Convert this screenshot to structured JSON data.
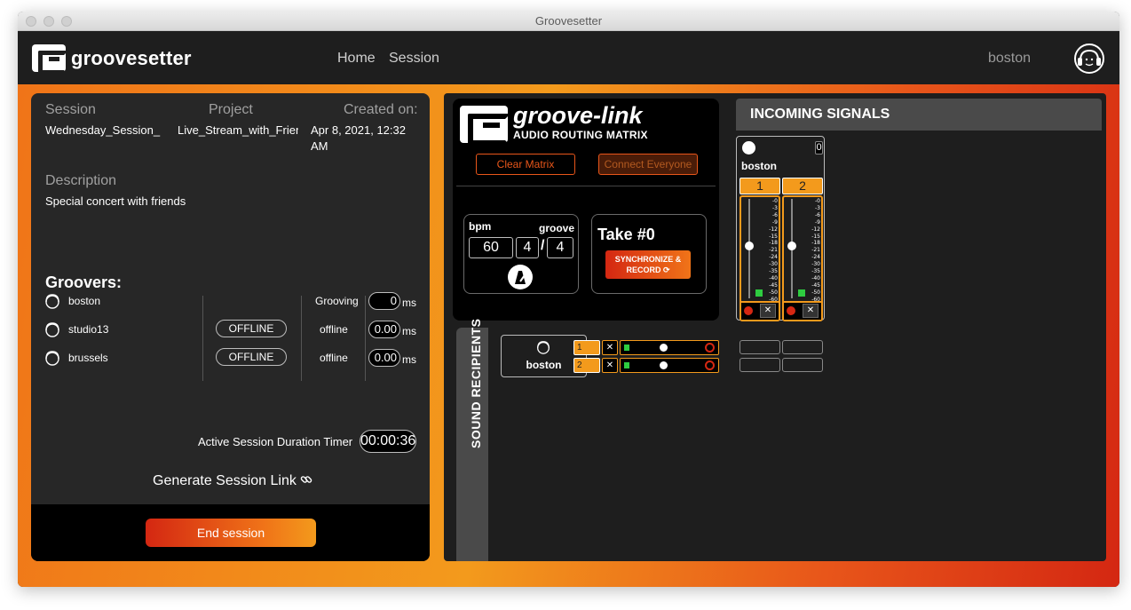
{
  "window": {
    "title": "Groovesetter"
  },
  "nav": {
    "brand": "groovesetter",
    "links": [
      "Home",
      "Session"
    ],
    "user": "boston"
  },
  "session": {
    "session_label": "Session",
    "project_label": "Project",
    "created_label": "Created on:",
    "session_value": "Wednesday_Session_",
    "project_value": "Live_Stream_with_Frien",
    "created_value_1": "Apr 8, 2021, 12:32",
    "created_value_2": "AM",
    "description_label": "Description",
    "description_value": "Special concert with friends",
    "groovers_title": "Groovers:",
    "groovers": [
      {
        "name": "boston",
        "button": "",
        "state": "Grooving",
        "latency": "0",
        "unit": "ms"
      },
      {
        "name": "studio13",
        "button": "OFFLINE",
        "state": "offline",
        "latency": "0.00",
        "unit": "ms"
      },
      {
        "name": "brussels",
        "button": "OFFLINE",
        "state": "offline",
        "latency": "0.00",
        "unit": "ms"
      }
    ],
    "timer_label": "Active Session Duration Timer",
    "timer_value": "00:00:36",
    "generate_link": "Generate Session Link",
    "end_button": "End session"
  },
  "groove_link": {
    "title": "groove-link",
    "subtitle": "AUDIO ROUTING MATRIX",
    "clear_button": "Clear Matrix",
    "connect_button": "Connect Everyone",
    "bpm_label": "bpm",
    "groove_label": "groove",
    "bpm": "60",
    "sig_top": "4",
    "sig_slash": "/",
    "sig_bottom": "4",
    "take": "Take #0",
    "sync_button_1": "SYNCHRONIZE &",
    "sync_button_2": "RECORD"
  },
  "incoming": {
    "header": "INCOMING SIGNALS",
    "source_name": "boston",
    "source_count": "0",
    "channels": [
      "1",
      "2"
    ],
    "scale": [
      "-0",
      "-3",
      "-6",
      "-9",
      "-12",
      "-15",
      "-18",
      "-21",
      "-24",
      "-30",
      "-35",
      "-40",
      "-45",
      "-50",
      "-60"
    ]
  },
  "recipients": {
    "label": "SOUND RECIPIENTS",
    "name": "boston",
    "routes": [
      "1",
      "2"
    ]
  },
  "colors": {
    "accent_orange": "#f39a1c",
    "accent_red": "#d42712",
    "meter_green": "#2ecc40"
  }
}
